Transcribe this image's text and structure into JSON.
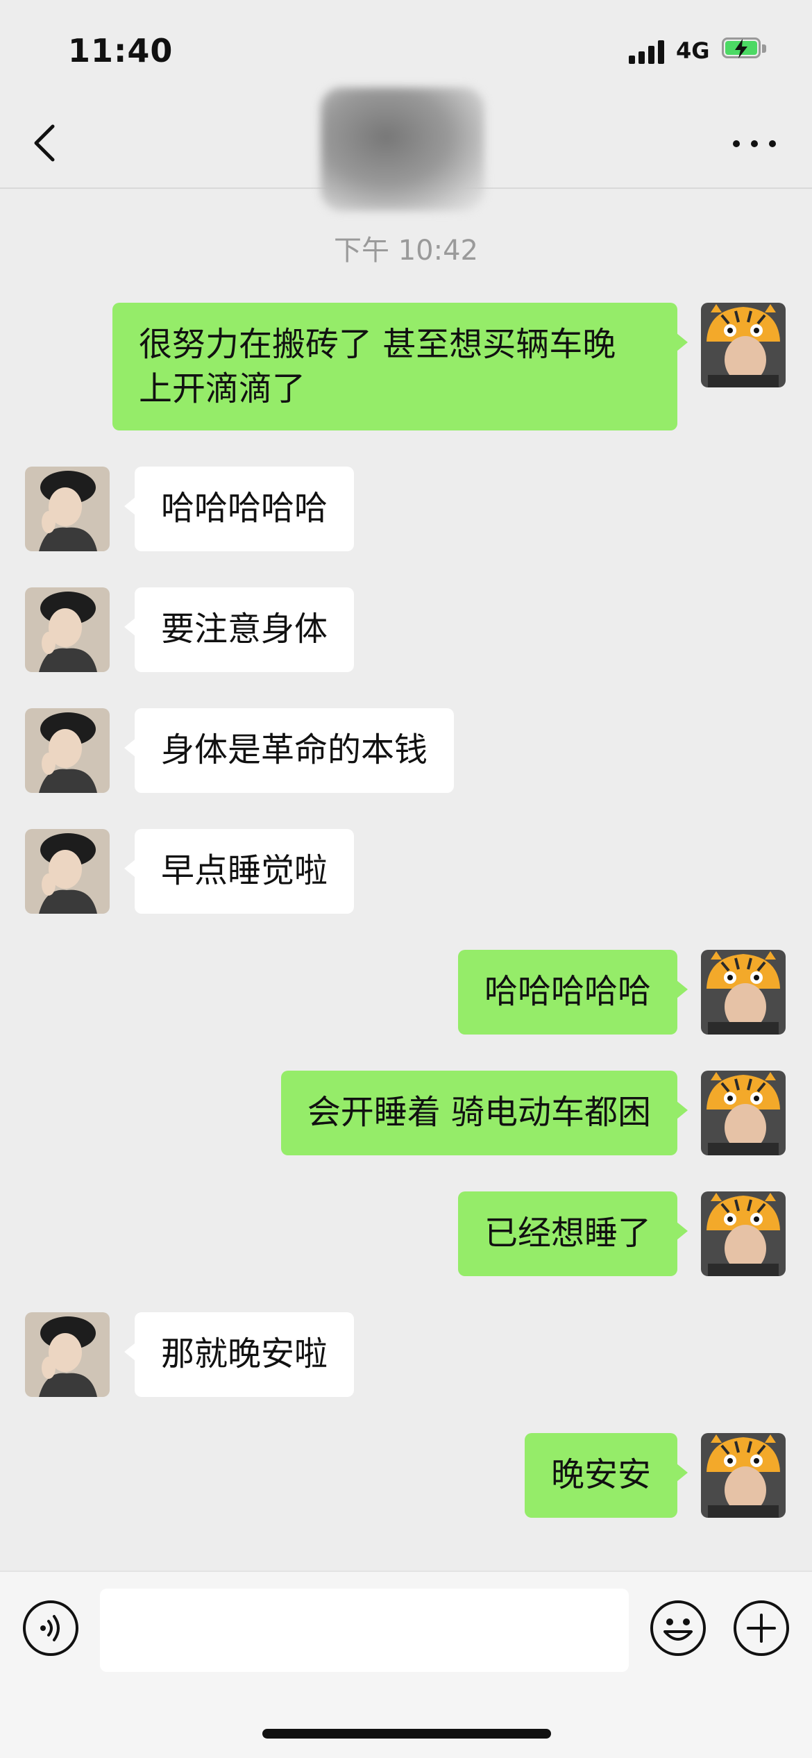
{
  "status_bar": {
    "time": "11:40",
    "network": "4G"
  },
  "chat": {
    "title": "",
    "timestamp": "下午 10:42",
    "messages": [
      {
        "side": "sent",
        "lines": [
          "很努力在搬砖了 甚至想买辆车晚",
          "上开滴滴了"
        ]
      },
      {
        "side": "received",
        "text": "哈哈哈哈哈"
      },
      {
        "side": "received",
        "text": "要注意身体"
      },
      {
        "side": "received",
        "text": "身体是革命的本钱"
      },
      {
        "side": "received",
        "text": "早点睡觉啦"
      },
      {
        "side": "sent",
        "text": "哈哈哈哈哈"
      },
      {
        "side": "sent",
        "text": "会开睡着 骑电动车都困"
      },
      {
        "side": "sent",
        "text": "已经想睡了"
      },
      {
        "side": "received",
        "text": "那就晚安啦"
      },
      {
        "side": "sent",
        "text": "晚安安"
      }
    ]
  },
  "input": {
    "value": "",
    "placeholder": ""
  },
  "icons": {
    "back": "chevron-left-icon",
    "more": "more-dots-icon",
    "voice": "voice-icon",
    "emoji": "emoji-icon",
    "plus": "plus-icon"
  },
  "colors": {
    "sent_bubble": "#95ec69",
    "received_bubble": "#ffffff",
    "background": "#ededed"
  }
}
